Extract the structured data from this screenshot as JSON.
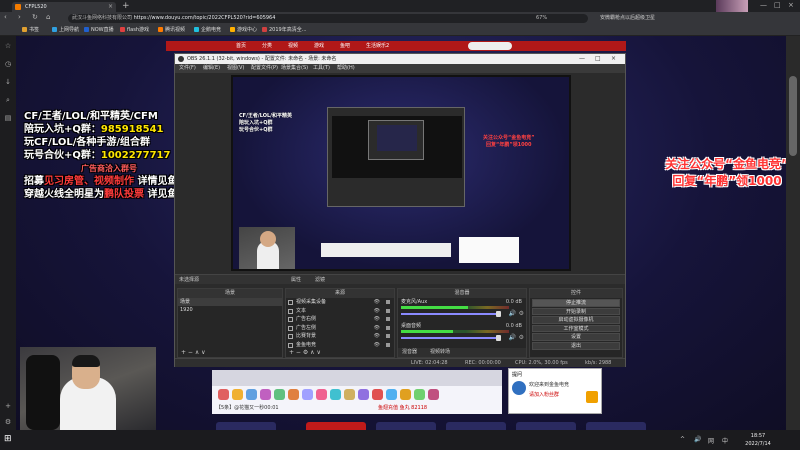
{
  "browser": {
    "tab_title": "CFPL520",
    "tab_close": "×",
    "new_tab": "+",
    "url_host": "武汉斗鱼网络科技有限公司",
    "url": "https://www.douyu.com/topic/2022CFPL520?rid=605964",
    "zoom": "67%",
    "extension_text": "安微霸枪点以后超级卫星",
    "window_controls": [
      "—",
      "□",
      "×"
    ],
    "nav_icons": [
      "back-icon",
      "forward-icon",
      "reload-icon",
      "home-icon"
    ]
  },
  "bookmarks": [
    {
      "label": "书签",
      "color": "#e0a030"
    },
    {
      "label": "上网导航",
      "color": "#30a0e0"
    },
    {
      "label": "NOW直播",
      "color": "#2060d0"
    },
    {
      "label": "flash游戏",
      "color": "#e04040"
    },
    {
      "label": "腾讯视频",
      "color": "#ff7a00"
    },
    {
      "label": "企鹅电竞",
      "color": "#20c0e0"
    },
    {
      "label": "游戏中心",
      "color": "#ffb000"
    },
    {
      "label": "2019年高清全...",
      "color": "#d04040"
    }
  ],
  "site_nav": [
    "首页",
    "分类",
    "视频",
    "游戏",
    "鱼吧",
    "生活娱乐2"
  ],
  "promo_left": {
    "line1": "CF/王者/LOL/和平精英/CFM",
    "line2": "陪玩入坑+Q群：",
    "line2_num": "985918541",
    "line3": "玩CF/LOL/各种手游/组合群",
    "line4": "玩号合伙+Q群：",
    "line4_num": "1002277717",
    "line5": "广告商洽入群号",
    "line6a": "招募",
    "line6b": "见习房管、视频制作",
    "line6c": " 详情见鱼吧",
    "line7a": "穿越火线全明星为",
    "line7b": "鹏队投票",
    "line7c": " 详见鱼吧"
  },
  "promo_right": {
    "line1": "关注公众号“金鱼电竞”",
    "line2": "回复“年鹏”领1000"
  },
  "obs": {
    "title": "OBS 26.1.1 (32-bit, windows) - 配置文件: 未命名 - 场景: 未命名",
    "window_controls": [
      "—",
      "□",
      "×"
    ],
    "menu": [
      "文件(F)",
      "编辑(E)",
      "视图(V)",
      "配置文件(P)",
      "场景集合(S)",
      "工具(T)",
      "帮助(H)"
    ],
    "preview_promo": [
      "CF/王者/LOL/和平精英",
      "陪玩入坑+Q群",
      "玩号合伙+Q群"
    ],
    "preview_promo_right": [
      "关注公众号“金鱼电竞”",
      "回复“年鹏”领1000"
    ],
    "scene_header": {
      "no_source": "未选择源",
      "properties": "属性",
      "filters": "滤镜"
    },
    "scenes": {
      "title": "场景",
      "items": [
        "场景",
        "1920"
      ],
      "footer": "+ − ∧ ∨"
    },
    "sources": {
      "title": "来源",
      "items": [
        "视频采集设备",
        "文本",
        "广告右侧",
        "广告左侧",
        "比赛背景",
        "金鱼电竞"
      ],
      "eye": "👁",
      "footer": "+ − ⚙ ∧ ∨"
    },
    "mixer": {
      "title": "混音器",
      "channels": [
        {
          "label": "麦克风/Aux",
          "db": "0.0 dB",
          "level": 0.62
        },
        {
          "label": "桌面音频",
          "db": "0.0 dB",
          "level": 0.48
        }
      ],
      "tabs": [
        "混音器",
        "视频转场"
      ],
      "speaker": "🔊",
      "gear": "⚙"
    },
    "controls": {
      "title": "控件",
      "buttons": [
        "停止推流",
        "开始录制",
        "启动虚拟摄像机",
        "工作室模式",
        "设置",
        "退出"
      ],
      "active_index": 0
    },
    "status": {
      "live": "LIVE: 02:04:28",
      "rec": "REC: 00:00:00",
      "cpu": "CPU: 2.0%, 30.00 fps",
      "kbps": "kb/s: 2988"
    }
  },
  "gift_bar": {
    "caption": "【5条】@花猫又一秒00:01",
    "caption2": "鱼翅充值  鱼丸 82118",
    "colors": [
      "#e06060",
      "#f0b030",
      "#60a0e0",
      "#c060c0",
      "#60c080",
      "#e08040",
      "#a0a0ff",
      "#f06090",
      "#40c0d0",
      "#d0b060",
      "#9070e0",
      "#e05050",
      "#50b0f0",
      "#e0a020",
      "#70d070",
      "#c05080"
    ]
  },
  "mini_banner": {
    "title": "提问",
    "line1": "欢迎来到金鱼电竞",
    "line2": "请加入粉丝群"
  },
  "taskbar": {
    "time": "18:57",
    "date": "2022/7/14",
    "tray": [
      "^",
      "🔊",
      "网",
      "中"
    ]
  }
}
